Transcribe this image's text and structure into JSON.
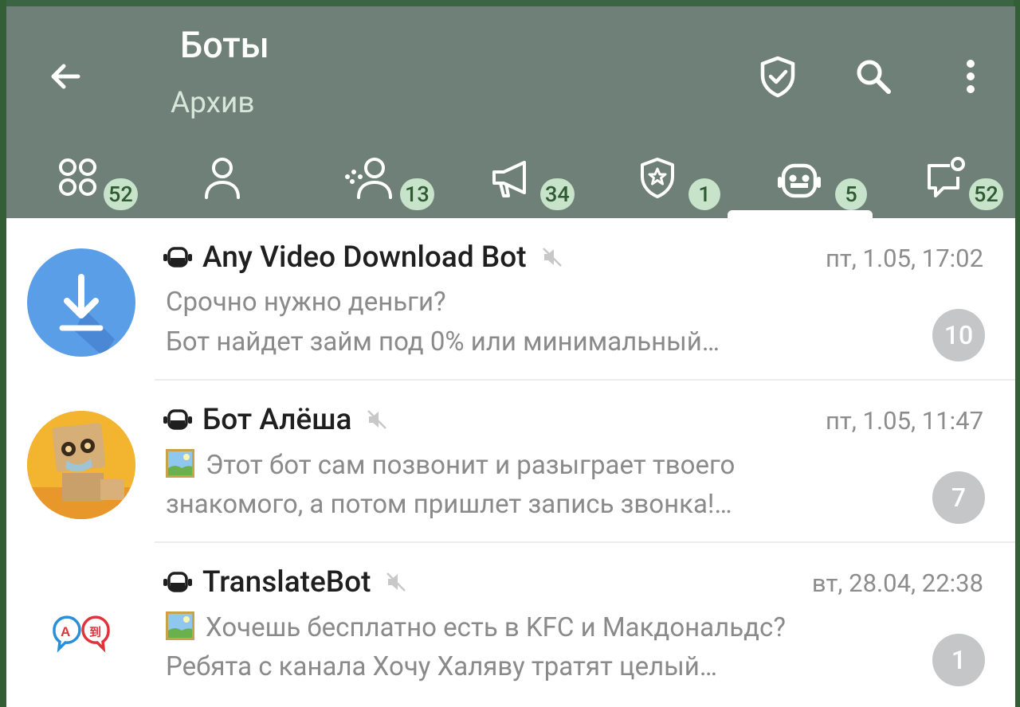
{
  "header": {
    "title": "Боты",
    "subtitle": "Архив",
    "back_icon": "arrow-left-icon",
    "shield_icon": "shield-check-icon",
    "search_icon": "search-icon",
    "menu_icon": "more-vert-icon",
    "background": "#6e8078"
  },
  "tabs": [
    {
      "icon": "all-chats-icon",
      "count": "52"
    },
    {
      "icon": "person-icon",
      "count": ""
    },
    {
      "icon": "groups-icon",
      "count": "13"
    },
    {
      "icon": "megaphone-icon",
      "count": "34"
    },
    {
      "icon": "shield-star-icon",
      "count": "1"
    },
    {
      "icon": "bot-icon",
      "count": "5",
      "active": true
    },
    {
      "icon": "chat-bubble-dot-icon",
      "count": "52"
    }
  ],
  "chats": [
    {
      "name": "Any Video Download Bot",
      "time": "пт, 1.05, 17:02",
      "line1": "Срочно нужно деньги?",
      "line2": "Бот найдет займ под 0% или минимальный…",
      "unread": "10",
      "muted": true,
      "avatar": "download-avatar"
    },
    {
      "name": "Бот Алёша",
      "time": "пт, 1.05, 11:47",
      "line1": "Этот бот сам позвонит и разыграет твоего",
      "line2": "знакомого, а потом пришлет запись звонка!…",
      "unread": "7",
      "muted": true,
      "avatar": "robot-avatar"
    },
    {
      "name": "TranslateBot",
      "time": "вт, 28.04, 22:38",
      "line1": "Хочешь бесплатно есть в KFC и Макдональдс?",
      "line2": "Ребята с канала Хочу Халяву тратят целый…",
      "unread": "1",
      "muted": true,
      "avatar": "translate-avatar"
    }
  ],
  "colors": {
    "accent": "#2f5a33",
    "badge_bg": "#c7e3c9",
    "unread_bg": "#c4c6c7"
  }
}
